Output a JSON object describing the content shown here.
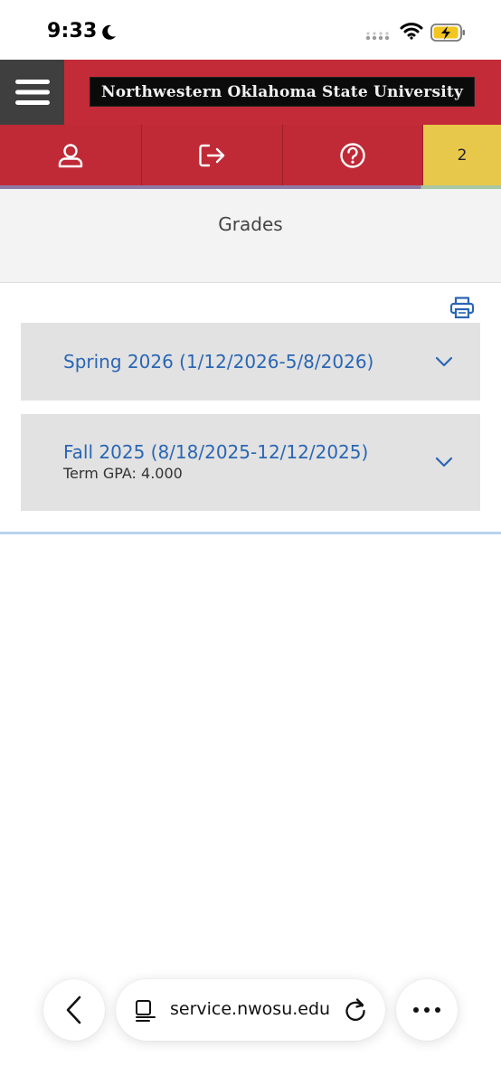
{
  "status_bar": {
    "time": "9:33"
  },
  "header": {
    "logo_text": "Northwestern Oklahoma State University",
    "brand_color": "#c22b37"
  },
  "nav": {
    "items": [
      {
        "icon": "user-icon"
      },
      {
        "icon": "sign-out-icon"
      },
      {
        "icon": "help-icon"
      },
      {
        "label": "2"
      }
    ]
  },
  "page": {
    "title": "Grades"
  },
  "terms": [
    {
      "title": "Spring 2026 (1/12/2026-5/8/2026)"
    },
    {
      "title": "Fall 2025 (8/18/2025-12/12/2025)",
      "gpa": "Term GPA: 4.000"
    }
  ],
  "browser": {
    "url": "service.nwosu.edu"
  },
  "colors": {
    "accent_link": "#2a66b4",
    "badge": "#e8c84b"
  }
}
